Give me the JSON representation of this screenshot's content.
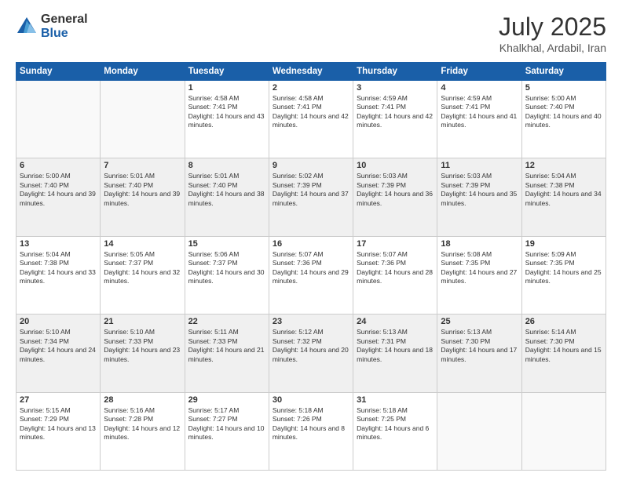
{
  "header": {
    "logo_general": "General",
    "logo_blue": "Blue",
    "month_year": "July 2025",
    "location": "Khalkhal, Ardabil, Iran"
  },
  "weekdays": [
    "Sunday",
    "Monday",
    "Tuesday",
    "Wednesday",
    "Thursday",
    "Friday",
    "Saturday"
  ],
  "weeks": [
    [
      {
        "day": "",
        "info": ""
      },
      {
        "day": "",
        "info": ""
      },
      {
        "day": "1",
        "info": "Sunrise: 4:58 AM\nSunset: 7:41 PM\nDaylight: 14 hours and 43 minutes."
      },
      {
        "day": "2",
        "info": "Sunrise: 4:58 AM\nSunset: 7:41 PM\nDaylight: 14 hours and 42 minutes."
      },
      {
        "day": "3",
        "info": "Sunrise: 4:59 AM\nSunset: 7:41 PM\nDaylight: 14 hours and 42 minutes."
      },
      {
        "day": "4",
        "info": "Sunrise: 4:59 AM\nSunset: 7:41 PM\nDaylight: 14 hours and 41 minutes."
      },
      {
        "day": "5",
        "info": "Sunrise: 5:00 AM\nSunset: 7:40 PM\nDaylight: 14 hours and 40 minutes."
      }
    ],
    [
      {
        "day": "6",
        "info": "Sunrise: 5:00 AM\nSunset: 7:40 PM\nDaylight: 14 hours and 39 minutes."
      },
      {
        "day": "7",
        "info": "Sunrise: 5:01 AM\nSunset: 7:40 PM\nDaylight: 14 hours and 39 minutes."
      },
      {
        "day": "8",
        "info": "Sunrise: 5:01 AM\nSunset: 7:40 PM\nDaylight: 14 hours and 38 minutes."
      },
      {
        "day": "9",
        "info": "Sunrise: 5:02 AM\nSunset: 7:39 PM\nDaylight: 14 hours and 37 minutes."
      },
      {
        "day": "10",
        "info": "Sunrise: 5:03 AM\nSunset: 7:39 PM\nDaylight: 14 hours and 36 minutes."
      },
      {
        "day": "11",
        "info": "Sunrise: 5:03 AM\nSunset: 7:39 PM\nDaylight: 14 hours and 35 minutes."
      },
      {
        "day": "12",
        "info": "Sunrise: 5:04 AM\nSunset: 7:38 PM\nDaylight: 14 hours and 34 minutes."
      }
    ],
    [
      {
        "day": "13",
        "info": "Sunrise: 5:04 AM\nSunset: 7:38 PM\nDaylight: 14 hours and 33 minutes."
      },
      {
        "day": "14",
        "info": "Sunrise: 5:05 AM\nSunset: 7:37 PM\nDaylight: 14 hours and 32 minutes."
      },
      {
        "day": "15",
        "info": "Sunrise: 5:06 AM\nSunset: 7:37 PM\nDaylight: 14 hours and 30 minutes."
      },
      {
        "day": "16",
        "info": "Sunrise: 5:07 AM\nSunset: 7:36 PM\nDaylight: 14 hours and 29 minutes."
      },
      {
        "day": "17",
        "info": "Sunrise: 5:07 AM\nSunset: 7:36 PM\nDaylight: 14 hours and 28 minutes."
      },
      {
        "day": "18",
        "info": "Sunrise: 5:08 AM\nSunset: 7:35 PM\nDaylight: 14 hours and 27 minutes."
      },
      {
        "day": "19",
        "info": "Sunrise: 5:09 AM\nSunset: 7:35 PM\nDaylight: 14 hours and 25 minutes."
      }
    ],
    [
      {
        "day": "20",
        "info": "Sunrise: 5:10 AM\nSunset: 7:34 PM\nDaylight: 14 hours and 24 minutes."
      },
      {
        "day": "21",
        "info": "Sunrise: 5:10 AM\nSunset: 7:33 PM\nDaylight: 14 hours and 23 minutes."
      },
      {
        "day": "22",
        "info": "Sunrise: 5:11 AM\nSunset: 7:33 PM\nDaylight: 14 hours and 21 minutes."
      },
      {
        "day": "23",
        "info": "Sunrise: 5:12 AM\nSunset: 7:32 PM\nDaylight: 14 hours and 20 minutes."
      },
      {
        "day": "24",
        "info": "Sunrise: 5:13 AM\nSunset: 7:31 PM\nDaylight: 14 hours and 18 minutes."
      },
      {
        "day": "25",
        "info": "Sunrise: 5:13 AM\nSunset: 7:30 PM\nDaylight: 14 hours and 17 minutes."
      },
      {
        "day": "26",
        "info": "Sunrise: 5:14 AM\nSunset: 7:30 PM\nDaylight: 14 hours and 15 minutes."
      }
    ],
    [
      {
        "day": "27",
        "info": "Sunrise: 5:15 AM\nSunset: 7:29 PM\nDaylight: 14 hours and 13 minutes."
      },
      {
        "day": "28",
        "info": "Sunrise: 5:16 AM\nSunset: 7:28 PM\nDaylight: 14 hours and 12 minutes."
      },
      {
        "day": "29",
        "info": "Sunrise: 5:17 AM\nSunset: 7:27 PM\nDaylight: 14 hours and 10 minutes."
      },
      {
        "day": "30",
        "info": "Sunrise: 5:18 AM\nSunset: 7:26 PM\nDaylight: 14 hours and 8 minutes."
      },
      {
        "day": "31",
        "info": "Sunrise: 5:18 AM\nSunset: 7:25 PM\nDaylight: 14 hours and 6 minutes."
      },
      {
        "day": "",
        "info": ""
      },
      {
        "day": "",
        "info": ""
      }
    ]
  ]
}
